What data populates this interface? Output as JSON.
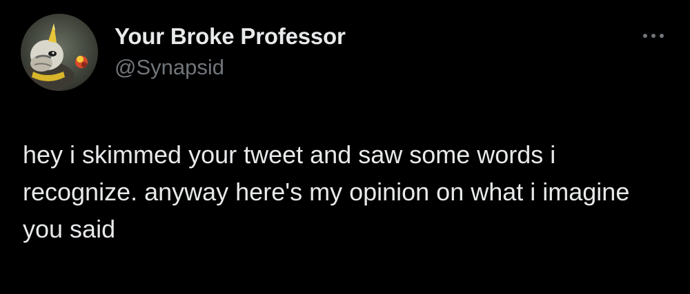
{
  "tweet": {
    "author": {
      "display_name": "Your Broke Professor",
      "handle": "@Synapsid",
      "avatar_icon": "creature-avatar"
    },
    "more_icon": "more-options-icon",
    "text": "hey i skimmed your tweet and saw some words i recognize. anyway here's my opinion on what i imagine you said"
  },
  "colors": {
    "background": "#000000",
    "primary_text": "#e7e9ea",
    "secondary_text": "#71767b"
  }
}
